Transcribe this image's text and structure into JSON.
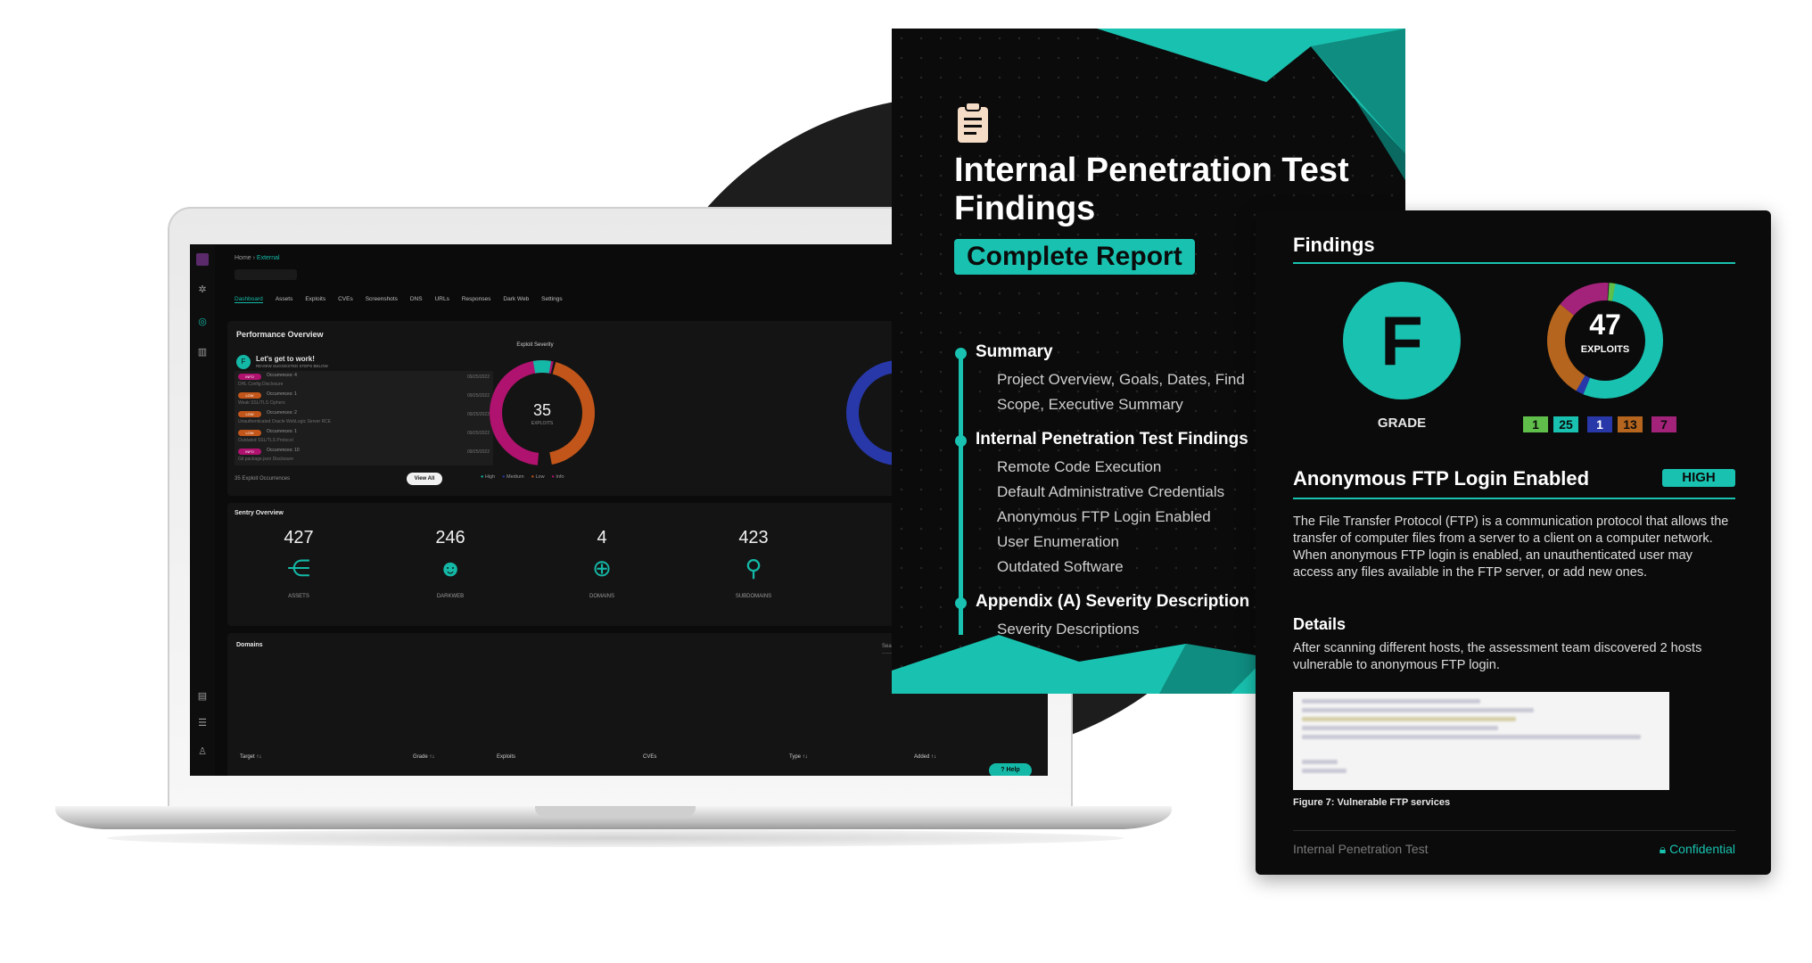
{
  "dashboard": {
    "breadcrumb": {
      "home": "Home",
      "current": "External"
    },
    "tabs": [
      "Dashboard",
      "Assets",
      "Exploits",
      "CVEs",
      "Screenshots",
      "DNS",
      "URLs",
      "Responses",
      "Dark Web",
      "Settings"
    ],
    "performance_title": "Performance Overview",
    "welcome": {
      "title": "Let's get to work!",
      "subtitle": "REVIEW SUGGESTED STEPS BELOW"
    },
    "occurrences": [
      {
        "badge": "INFO",
        "badge_color": "#b0126f",
        "label": "Occurrences: 4",
        "date": "09/25/2022",
        "sub": "DHL Config Disclosure"
      },
      {
        "badge": "LOW",
        "badge_color": "#c2561a",
        "label": "Occurrences: 1",
        "date": "09/25/2022",
        "sub": "Weak SSL/TLS Ciphers"
      },
      {
        "badge": "LOW",
        "badge_color": "#c2561a",
        "label": "Occurrences: 2",
        "date": "09/25/2022",
        "sub": "Unauthenticated Oracle WebLogic Server RCE"
      },
      {
        "badge": "LOW",
        "badge_color": "#c2561a",
        "label": "Occurrences: 1",
        "date": "09/25/2022",
        "sub": "Outdated SSL/TLS Protocol"
      },
      {
        "badge": "INFO",
        "badge_color": "#b0126f",
        "label": "Occurrences: 10",
        "date": "09/25/2022",
        "sub": "Git package.json Disclosure"
      }
    ],
    "exploit_occurrences": "35 Exploit Occurrences",
    "view_all": "View All",
    "exploit_severity": {
      "title": "Exploit Severity",
      "total": "35",
      "unit": "EXPLOITS",
      "legend": [
        "High",
        "Medium",
        "Low",
        "Info"
      ],
      "colors": [
        "#14b8a6",
        "#2838a8",
        "#c2561a",
        "#b0126f"
      ]
    },
    "sentry": {
      "title": "Sentry Overview",
      "stats": [
        {
          "value": "427",
          "label": "ASSETS",
          "icon": "share-nodes-icon",
          "glyph": "⋲"
        },
        {
          "value": "246",
          "label": "DARKWEB",
          "icon": "hacker-icon",
          "glyph": "☻"
        },
        {
          "value": "4",
          "label": "DOMAINS",
          "icon": "globe-icon",
          "glyph": "⊕"
        },
        {
          "value": "423",
          "label": "SUBDOMAINS",
          "icon": "subdomain-icon",
          "glyph": "⚲"
        }
      ]
    },
    "domains": {
      "title": "Domains",
      "search_placeholder": "Search",
      "columns": [
        "Target ↑↓",
        "Grade ↑↓",
        "Exploits",
        "CVEs",
        "Type ↑↓",
        "Added ↑↓"
      ]
    },
    "help": "Help"
  },
  "report": {
    "title": "Internal Penetration Test Findings",
    "subtitle": "Complete Report",
    "toc": [
      {
        "heading": "Summary",
        "items": [
          "Project Overview, Goals, Dates, Find",
          "Scope, Executive Summary"
        ]
      },
      {
        "heading": "Internal Penetration Test Findings",
        "items": [
          "Remote Code Execution",
          "Default Administrative Credentials",
          "Anonymous FTP Login Enabled",
          "User Enumeration",
          "Outdated Software"
        ]
      },
      {
        "heading": "Appendix (A) Severity Description",
        "items": [
          "Severity Descriptions"
        ]
      }
    ]
  },
  "findings": {
    "title": "Findings",
    "grade": "F",
    "grade_label": "GRADE",
    "exploits_total": "47",
    "exploits_unit": "EXPLOITS",
    "severity_counts": [
      {
        "value": "1",
        "color": "#5fbf4a"
      },
      {
        "value": "25",
        "color": "#19c2b0"
      },
      {
        "value": "1",
        "color": "#2838a8"
      },
      {
        "value": "13",
        "color": "#b5651d"
      },
      {
        "value": "7",
        "color": "#a3237a"
      }
    ],
    "issue_title": "Anonymous FTP Login Enabled",
    "issue_severity": "HIGH",
    "description": "The File Transfer Protocol (FTP) is a communication protocol that allows the transfer of computer files from a server to a client on a computer network. When anonymous FTP login is enabled, an unauthenticated user may access any files available in the FTP server, or add new ones.",
    "details_heading": "Details",
    "details": "After scanning different hosts, the assessment team discovered 2 hosts vulnerable to anonymous FTP login.",
    "figure_caption": "Figure 7: Vulnerable FTP services",
    "footer_left": "Internal Penetration Test",
    "footer_right": "Confidential"
  }
}
